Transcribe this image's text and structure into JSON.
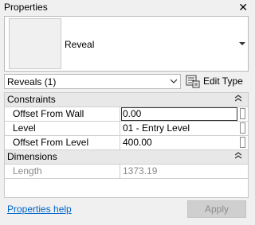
{
  "window": {
    "title": "Properties"
  },
  "type_selector": {
    "type_name": "Reveal"
  },
  "instance_filter": {
    "value": "Reveals (1)"
  },
  "edit_type": {
    "label": "Edit Type"
  },
  "sections": {
    "constraints": {
      "label": "Constraints",
      "rows": [
        {
          "label": "Offset From Wall",
          "value": "0.00"
        },
        {
          "label": "Level",
          "value": "01 - Entry Level"
        },
        {
          "label": "Offset From Level",
          "value": "400.00"
        }
      ]
    },
    "dimensions": {
      "label": "Dimensions",
      "rows": [
        {
          "label": "Length",
          "value": "1373.19"
        }
      ]
    }
  },
  "footer": {
    "help_link": "Properties help",
    "apply_label": "Apply"
  },
  "colors": {
    "link": "#0066cc",
    "section_bg": "#e8e8e8",
    "disabled_text": "#8a8a8a"
  },
  "icons": [
    "close-icon",
    "dropdown-arrow-icon",
    "chevron-down-icon",
    "edit-type-icon",
    "collapse-icon"
  ]
}
